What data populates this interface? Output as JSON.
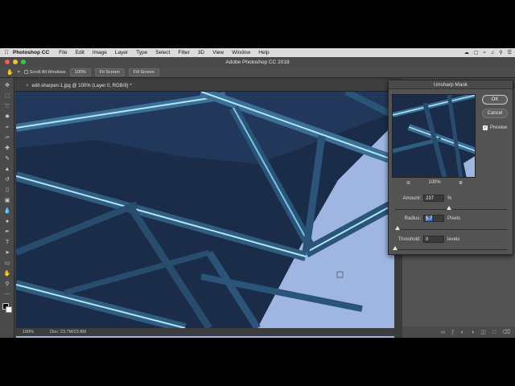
{
  "menubar": {
    "app_name": "Photoshop CC",
    "items": [
      "File",
      "Edit",
      "Image",
      "Layer",
      "Type",
      "Select",
      "Filter",
      "3D",
      "View",
      "Window",
      "Help"
    ]
  },
  "window": {
    "title": "Adobe Photoshop CC 2018"
  },
  "options_bar": {
    "scroll_all_windows": "Scroll All Windows",
    "btn_100": "100%",
    "btn_fit_screen": "Fit Screen",
    "btn_fill_screen": "Fill Screen"
  },
  "document": {
    "tab_title": "edit-sharpen-1.jpg @ 100% (Layer 0, RGB/8) *",
    "zoom": "100%",
    "doc_size": "Doc: 23.7M/23.8M"
  },
  "dialog": {
    "title": "Unsharp Mask",
    "ok_label": "OK",
    "cancel_label": "Cancel",
    "preview_label": "Preview",
    "zoom_level": "100%",
    "amount": {
      "label": "Amount:",
      "value": "237",
      "unit": "%",
      "level": 0.48
    },
    "radius": {
      "label": "Radius:",
      "value": "5.7",
      "unit": "Pixels",
      "level": 0.02
    },
    "threshold": {
      "label": "Threshold:",
      "value": "0",
      "unit": "levels",
      "level": 0.0
    }
  },
  "colors": {
    "accent": "#3c75c4",
    "sky": "#9fb6e3",
    "steel": "#1a2c48",
    "highlight": "#aee8f8"
  }
}
